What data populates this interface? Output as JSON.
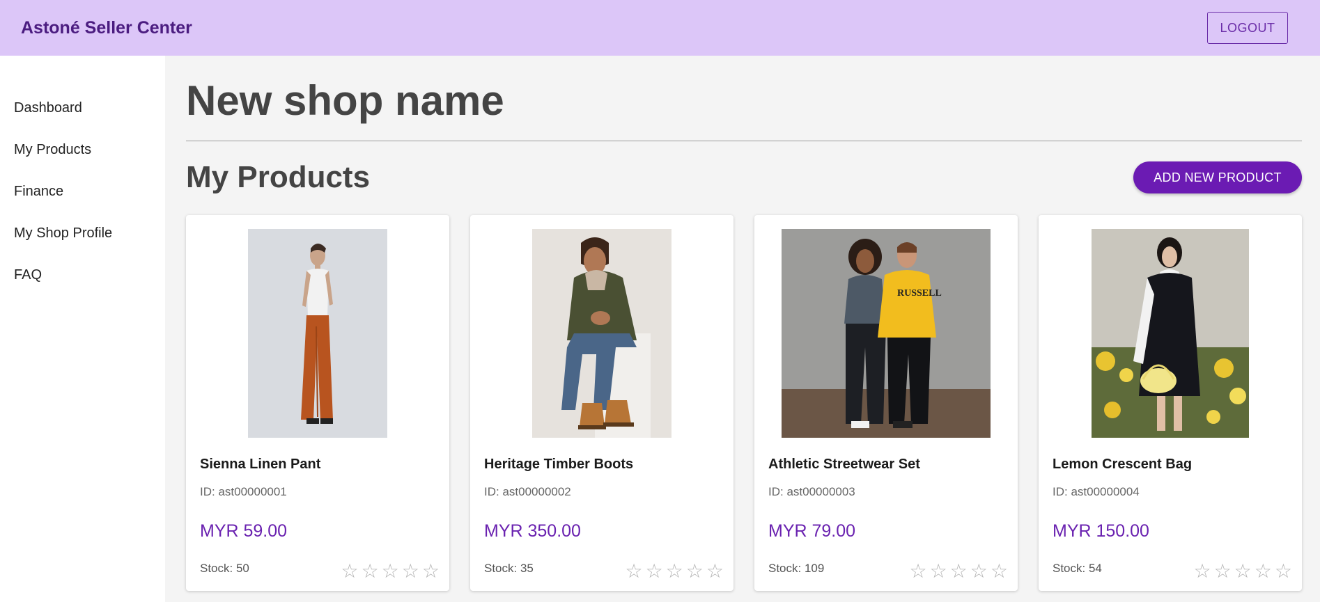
{
  "header": {
    "brand": "Astoné Seller Center",
    "logout_label": "LOGOUT"
  },
  "sidebar": {
    "items": [
      {
        "label": "Dashboard"
      },
      {
        "label": "My Products"
      },
      {
        "label": "Finance"
      },
      {
        "label": "My Shop Profile"
      },
      {
        "label": "FAQ"
      }
    ]
  },
  "main": {
    "shop_name": "New shop name",
    "section_title": "My Products",
    "add_button_label": "ADD NEW PRODUCT",
    "products": [
      {
        "name": "Sienna Linen Pant",
        "id": "ID: ast00000001",
        "price": "MYR 59.00",
        "stock": "Stock: 50",
        "rating": 0
      },
      {
        "name": "Heritage Timber Boots",
        "id": "ID: ast00000002",
        "price": "MYR 350.00",
        "stock": "Stock: 35",
        "rating": 0
      },
      {
        "name": "Athletic Streetwear Set",
        "id": "ID: ast00000003",
        "price": "MYR 79.00",
        "stock": "Stock: 109",
        "rating": 0
      },
      {
        "name": "Lemon Crescent Bag",
        "id": "ID: ast00000004",
        "price": "MYR 150.00",
        "stock": "Stock: 54",
        "rating": 0
      }
    ]
  },
  "colors": {
    "header_bg": "#dcc6f8",
    "brand_text": "#4b1c80",
    "accent": "#6b1bb3",
    "price": "#6a22b0"
  },
  "icons": {
    "rating_star": "star-outline-icon"
  }
}
